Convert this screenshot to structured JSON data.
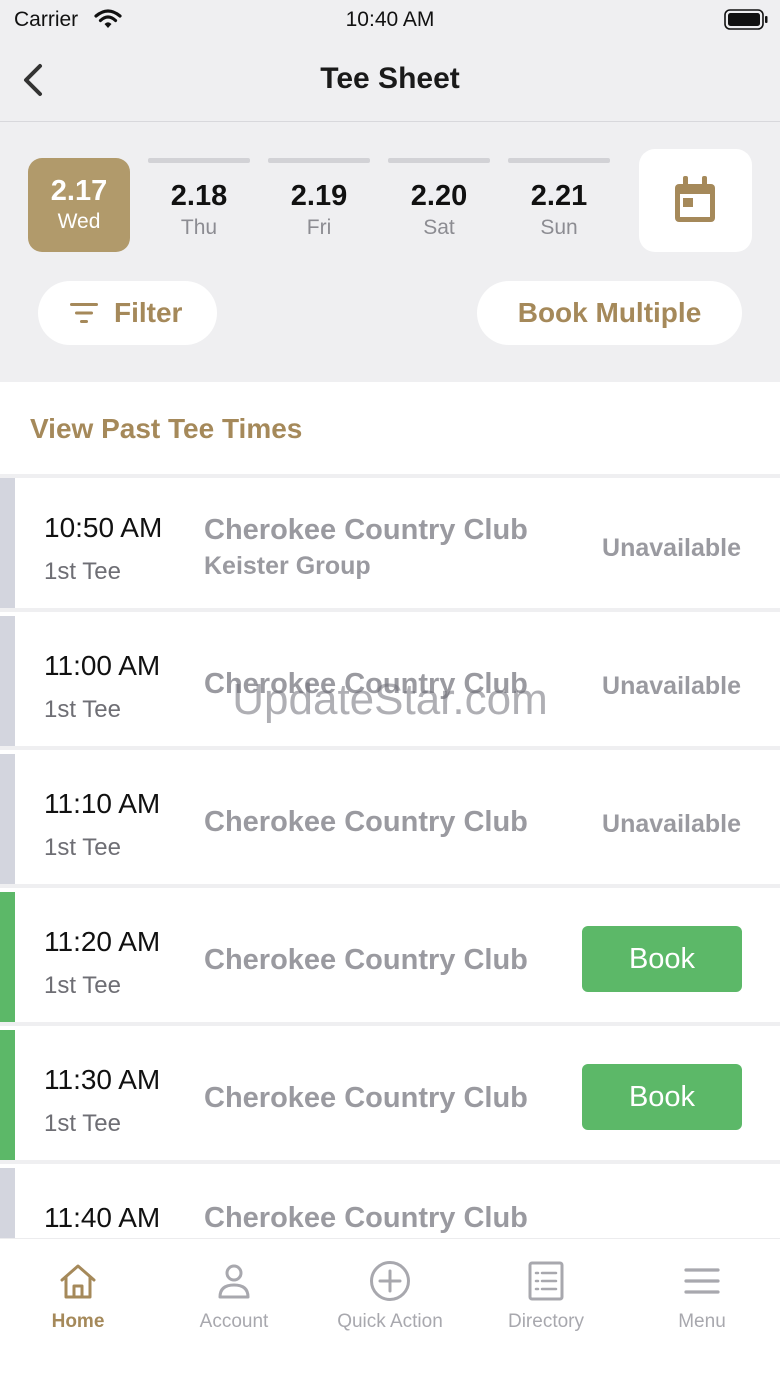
{
  "status_bar": {
    "carrier": "Carrier",
    "time": "10:40 AM"
  },
  "nav": {
    "title": "Tee Sheet",
    "back_icon": "chevron-left-icon"
  },
  "dates": [
    {
      "date": "2.17",
      "day": "Wed",
      "selected": true
    },
    {
      "date": "2.18",
      "day": "Thu",
      "selected": false
    },
    {
      "date": "2.19",
      "day": "Fri",
      "selected": false
    },
    {
      "date": "2.20",
      "day": "Sat",
      "selected": false
    },
    {
      "date": "2.21",
      "day": "Sun",
      "selected": false
    }
  ],
  "filter": {
    "label": "Filter",
    "icon": "filter-icon"
  },
  "book_multiple": {
    "label": "Book Multiple"
  },
  "past_tee_times": {
    "label": "View Past Tee Times"
  },
  "tee_times": [
    {
      "time": "10:50 AM",
      "tee": "1st Tee",
      "club": "Cherokee Country Club",
      "group": "Keister Group",
      "status": "Unavailable"
    },
    {
      "time": "11:00 AM",
      "tee": "1st Tee",
      "club": "Cherokee Country Club",
      "status": "Unavailable"
    },
    {
      "time": "11:10 AM",
      "tee": "1st Tee",
      "club": "Cherokee Country Club",
      "status": "Unavailable"
    },
    {
      "time": "11:20 AM",
      "tee": "1st Tee",
      "club": "Cherokee Country Club",
      "action": "Book"
    },
    {
      "time": "11:30 AM",
      "tee": "1st Tee",
      "club": "Cherokee Country Club",
      "action": "Book"
    },
    {
      "time": "11:40 AM",
      "club": "Cherokee Country Club"
    }
  ],
  "watermark": "UpdateStar.com",
  "tabs": [
    {
      "label": "Home",
      "icon": "home-icon",
      "active": true
    },
    {
      "label": "Account",
      "icon": "user-icon",
      "active": false
    },
    {
      "label": "Quick Action",
      "icon": "plus-circle-icon",
      "active": false
    },
    {
      "label": "Directory",
      "icon": "directory-icon",
      "active": false
    },
    {
      "label": "Menu",
      "icon": "menu-icon",
      "active": false
    }
  ],
  "colors": {
    "accent": "#a5895a",
    "selected_date_bg": "#b19a6b",
    "available_green": "#5cb868",
    "unavailable_strip": "#d3d5de",
    "header_bg": "#efeff1"
  }
}
